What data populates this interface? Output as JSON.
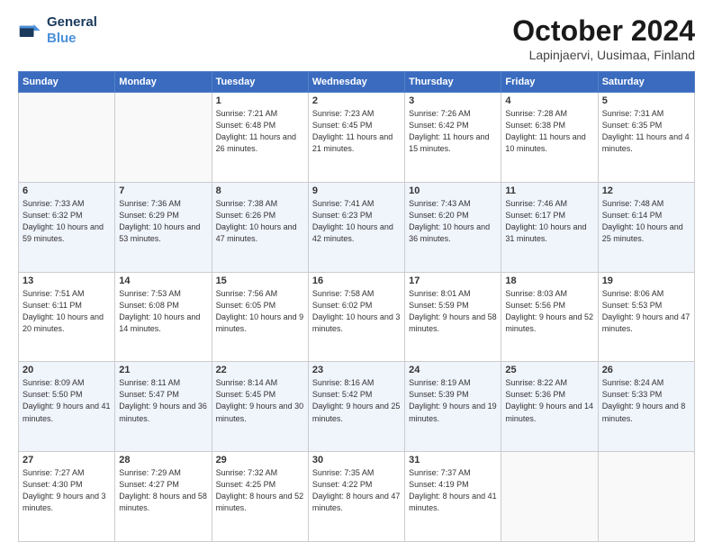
{
  "logo": {
    "line1": "General",
    "line2": "Blue"
  },
  "title": "October 2024",
  "location": "Lapinjaervi, Uusimaa, Finland",
  "weekdays": [
    "Sunday",
    "Monday",
    "Tuesday",
    "Wednesday",
    "Thursday",
    "Friday",
    "Saturday"
  ],
  "weeks": [
    [
      {
        "day": null
      },
      {
        "day": null
      },
      {
        "day": "1",
        "sunrise": "Sunrise: 7:21 AM",
        "sunset": "Sunset: 6:48 PM",
        "daylight": "Daylight: 11 hours and 26 minutes."
      },
      {
        "day": "2",
        "sunrise": "Sunrise: 7:23 AM",
        "sunset": "Sunset: 6:45 PM",
        "daylight": "Daylight: 11 hours and 21 minutes."
      },
      {
        "day": "3",
        "sunrise": "Sunrise: 7:26 AM",
        "sunset": "Sunset: 6:42 PM",
        "daylight": "Daylight: 11 hours and 15 minutes."
      },
      {
        "day": "4",
        "sunrise": "Sunrise: 7:28 AM",
        "sunset": "Sunset: 6:38 PM",
        "daylight": "Daylight: 11 hours and 10 minutes."
      },
      {
        "day": "5",
        "sunrise": "Sunrise: 7:31 AM",
        "sunset": "Sunset: 6:35 PM",
        "daylight": "Daylight: 11 hours and 4 minutes."
      }
    ],
    [
      {
        "day": "6",
        "sunrise": "Sunrise: 7:33 AM",
        "sunset": "Sunset: 6:32 PM",
        "daylight": "Daylight: 10 hours and 59 minutes."
      },
      {
        "day": "7",
        "sunrise": "Sunrise: 7:36 AM",
        "sunset": "Sunset: 6:29 PM",
        "daylight": "Daylight: 10 hours and 53 minutes."
      },
      {
        "day": "8",
        "sunrise": "Sunrise: 7:38 AM",
        "sunset": "Sunset: 6:26 PM",
        "daylight": "Daylight: 10 hours and 47 minutes."
      },
      {
        "day": "9",
        "sunrise": "Sunrise: 7:41 AM",
        "sunset": "Sunset: 6:23 PM",
        "daylight": "Daylight: 10 hours and 42 minutes."
      },
      {
        "day": "10",
        "sunrise": "Sunrise: 7:43 AM",
        "sunset": "Sunset: 6:20 PM",
        "daylight": "Daylight: 10 hours and 36 minutes."
      },
      {
        "day": "11",
        "sunrise": "Sunrise: 7:46 AM",
        "sunset": "Sunset: 6:17 PM",
        "daylight": "Daylight: 10 hours and 31 minutes."
      },
      {
        "day": "12",
        "sunrise": "Sunrise: 7:48 AM",
        "sunset": "Sunset: 6:14 PM",
        "daylight": "Daylight: 10 hours and 25 minutes."
      }
    ],
    [
      {
        "day": "13",
        "sunrise": "Sunrise: 7:51 AM",
        "sunset": "Sunset: 6:11 PM",
        "daylight": "Daylight: 10 hours and 20 minutes."
      },
      {
        "day": "14",
        "sunrise": "Sunrise: 7:53 AM",
        "sunset": "Sunset: 6:08 PM",
        "daylight": "Daylight: 10 hours and 14 minutes."
      },
      {
        "day": "15",
        "sunrise": "Sunrise: 7:56 AM",
        "sunset": "Sunset: 6:05 PM",
        "daylight": "Daylight: 10 hours and 9 minutes."
      },
      {
        "day": "16",
        "sunrise": "Sunrise: 7:58 AM",
        "sunset": "Sunset: 6:02 PM",
        "daylight": "Daylight: 10 hours and 3 minutes."
      },
      {
        "day": "17",
        "sunrise": "Sunrise: 8:01 AM",
        "sunset": "Sunset: 5:59 PM",
        "daylight": "Daylight: 9 hours and 58 minutes."
      },
      {
        "day": "18",
        "sunrise": "Sunrise: 8:03 AM",
        "sunset": "Sunset: 5:56 PM",
        "daylight": "Daylight: 9 hours and 52 minutes."
      },
      {
        "day": "19",
        "sunrise": "Sunrise: 8:06 AM",
        "sunset": "Sunset: 5:53 PM",
        "daylight": "Daylight: 9 hours and 47 minutes."
      }
    ],
    [
      {
        "day": "20",
        "sunrise": "Sunrise: 8:09 AM",
        "sunset": "Sunset: 5:50 PM",
        "daylight": "Daylight: 9 hours and 41 minutes."
      },
      {
        "day": "21",
        "sunrise": "Sunrise: 8:11 AM",
        "sunset": "Sunset: 5:47 PM",
        "daylight": "Daylight: 9 hours and 36 minutes."
      },
      {
        "day": "22",
        "sunrise": "Sunrise: 8:14 AM",
        "sunset": "Sunset: 5:45 PM",
        "daylight": "Daylight: 9 hours and 30 minutes."
      },
      {
        "day": "23",
        "sunrise": "Sunrise: 8:16 AM",
        "sunset": "Sunset: 5:42 PM",
        "daylight": "Daylight: 9 hours and 25 minutes."
      },
      {
        "day": "24",
        "sunrise": "Sunrise: 8:19 AM",
        "sunset": "Sunset: 5:39 PM",
        "daylight": "Daylight: 9 hours and 19 minutes."
      },
      {
        "day": "25",
        "sunrise": "Sunrise: 8:22 AM",
        "sunset": "Sunset: 5:36 PM",
        "daylight": "Daylight: 9 hours and 14 minutes."
      },
      {
        "day": "26",
        "sunrise": "Sunrise: 8:24 AM",
        "sunset": "Sunset: 5:33 PM",
        "daylight": "Daylight: 9 hours and 8 minutes."
      }
    ],
    [
      {
        "day": "27",
        "sunrise": "Sunrise: 7:27 AM",
        "sunset": "Sunset: 4:30 PM",
        "daylight": "Daylight: 9 hours and 3 minutes."
      },
      {
        "day": "28",
        "sunrise": "Sunrise: 7:29 AM",
        "sunset": "Sunset: 4:27 PM",
        "daylight": "Daylight: 8 hours and 58 minutes."
      },
      {
        "day": "29",
        "sunrise": "Sunrise: 7:32 AM",
        "sunset": "Sunset: 4:25 PM",
        "daylight": "Daylight: 8 hours and 52 minutes."
      },
      {
        "day": "30",
        "sunrise": "Sunrise: 7:35 AM",
        "sunset": "Sunset: 4:22 PM",
        "daylight": "Daylight: 8 hours and 47 minutes."
      },
      {
        "day": "31",
        "sunrise": "Sunrise: 7:37 AM",
        "sunset": "Sunset: 4:19 PM",
        "daylight": "Daylight: 8 hours and 41 minutes."
      },
      {
        "day": null
      },
      {
        "day": null
      }
    ]
  ]
}
